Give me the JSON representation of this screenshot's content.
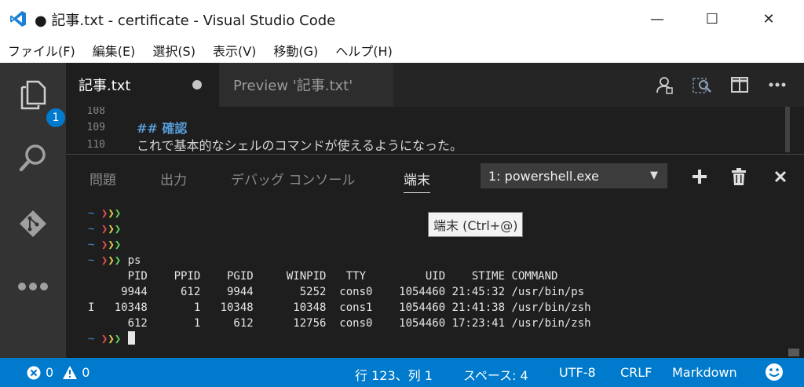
{
  "window": {
    "title": "● 記事.txt - certificate - Visual Studio Code",
    "minimize_glyph": "—",
    "maximize_glyph": "☐",
    "close_glyph": "✕"
  },
  "menu": [
    "ファイル(F)",
    "編集(E)",
    "選択(S)",
    "表示(V)",
    "移動(G)",
    "ヘルプ(H)"
  ],
  "activity": {
    "explorer_badge": "1",
    "icons": [
      "files-icon",
      "search-icon",
      "git-icon",
      "more-icon"
    ]
  },
  "tabs": {
    "active": "記事.txt",
    "preview": "Preview '記事.txt'"
  },
  "editor": {
    "lines": [
      {
        "num": "108",
        "text": ""
      },
      {
        "num": "109",
        "text": "## 確認"
      },
      {
        "num": "110",
        "text": "これで基本的なシェルのコマンドが使えるようになった。"
      }
    ]
  },
  "panel": {
    "tabs": [
      "問題",
      "出力",
      "デバッグ コンソール",
      "端末"
    ],
    "active_tab": "端末",
    "terminal_select": "1: powershell.exe",
    "tooltip": "端末 (Ctrl+@)"
  },
  "terminal": {
    "tilde": "~",
    "prompt": "❯❯❯",
    "command": "ps",
    "ps_header": "      PID    PPID    PGID     WINPID   TTY         UID    STIME COMMAND",
    "ps_rows": [
      "     9944     612    9944       5252  cons0    1054460 21:45:32 /usr/bin/ps",
      "I   10348       1   10348      10348  cons1    1054460 21:41:38 /usr/bin/zsh",
      "      612       1     612      12756  cons0    1054460 17:23:41 /usr/bin/zsh"
    ]
  },
  "status": {
    "errors": "0",
    "warnings": "0",
    "position": "行 123、列 1",
    "spaces": "スペース: 4",
    "encoding": "UTF-8",
    "eol": "CRLF",
    "language": "Markdown"
  },
  "colors": {
    "statusbar": "#007acc",
    "activitybar": "#333333",
    "editor_bg": "#1e1e1e",
    "accent": "#007acc"
  }
}
